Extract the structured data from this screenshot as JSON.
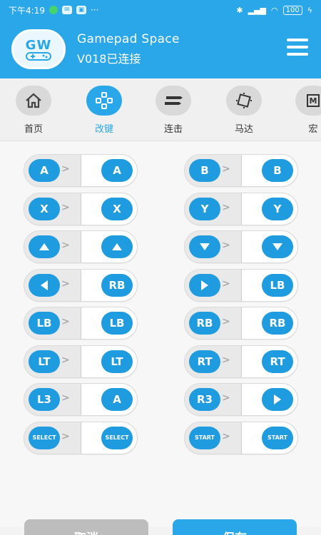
{
  "status": {
    "time": "下午4:19",
    "battery": "100",
    "icons": [
      "notification-icon",
      "chat-icon",
      "more-icon",
      "bluetooth-icon",
      "signal-icon",
      "wifi-icon",
      "charging-icon"
    ],
    "more": "···"
  },
  "header": {
    "logo_text": "GW",
    "title": "Gamepad Space",
    "subtitle": "V018已连接",
    "accent": "#2aa7e8"
  },
  "tabs": [
    {
      "label": "首页",
      "icon": "home-icon"
    },
    {
      "label": "改键",
      "icon": "gamepad-icon",
      "active": true
    },
    {
      "label": "连击",
      "icon": "rapid-fire-icon"
    },
    {
      "label": "马达",
      "icon": "motor-icon"
    },
    {
      "label": "宏",
      "icon": "macro-icon"
    }
  ],
  "mappings": [
    {
      "from": "A",
      "to": "A"
    },
    {
      "from": "B",
      "to": "B"
    },
    {
      "from": "X",
      "to": "X"
    },
    {
      "from": "Y",
      "to": "Y"
    },
    {
      "from": "up",
      "to": "up"
    },
    {
      "from": "down",
      "to": "down"
    },
    {
      "from": "left",
      "to": "RB"
    },
    {
      "from": "right",
      "to": "LB"
    },
    {
      "from": "LB",
      "to": "LB"
    },
    {
      "from": "RB",
      "to": "RB"
    },
    {
      "from": "LT",
      "to": "LT"
    },
    {
      "from": "RT",
      "to": "RT"
    },
    {
      "from": "L3",
      "to": "A"
    },
    {
      "from": "R3",
      "to": "right"
    },
    {
      "from": "SELECT",
      "to": "SELECT"
    },
    {
      "from": "START",
      "to": "START"
    }
  ],
  "arrow": ">",
  "buttons": {
    "cancel": "取消",
    "save": "保存"
  }
}
